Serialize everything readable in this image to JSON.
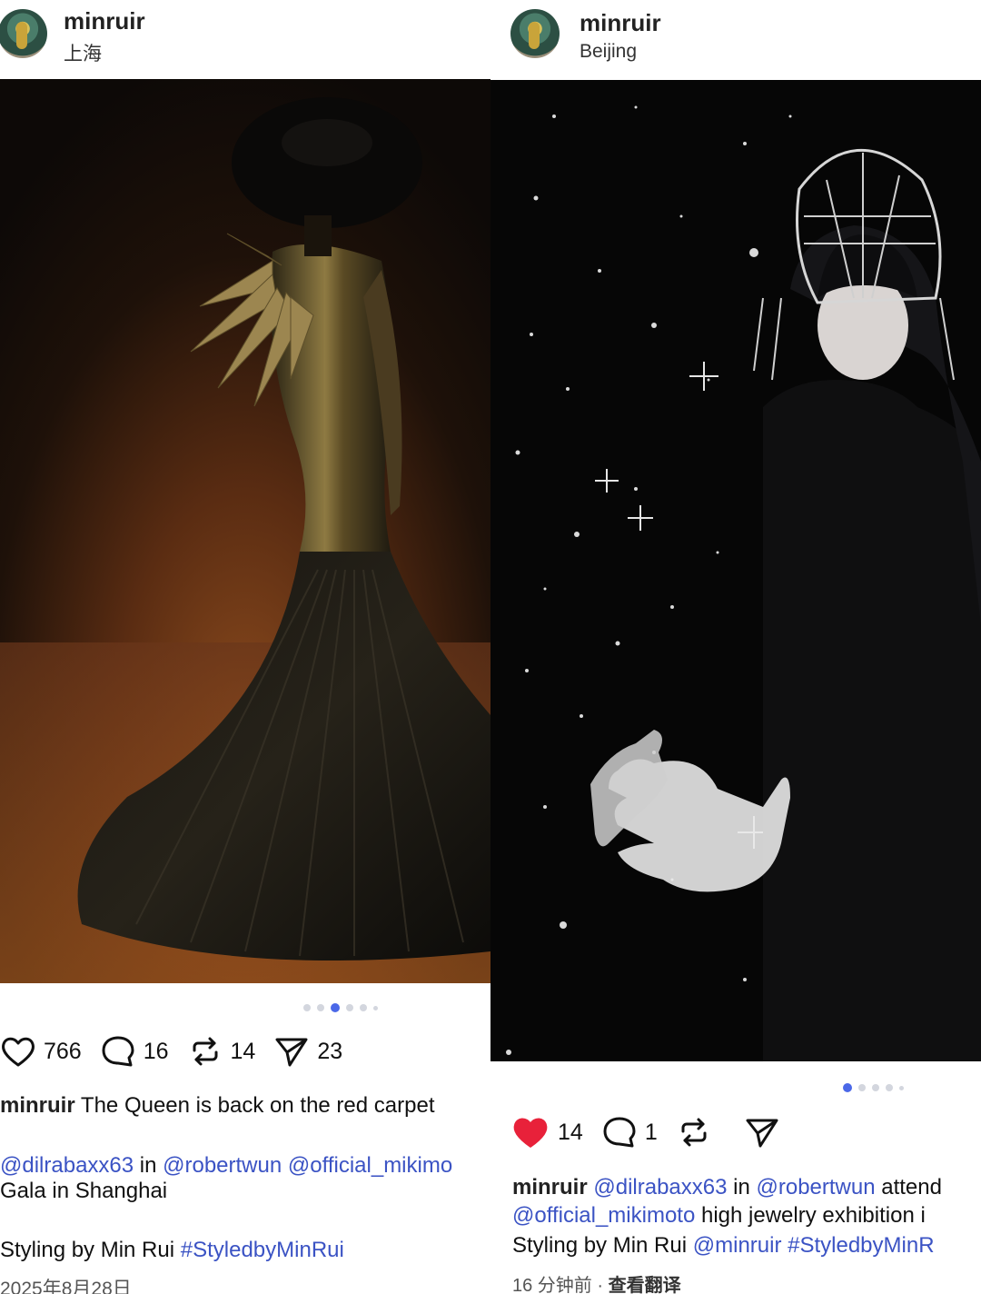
{
  "left_post": {
    "username": "minruir",
    "location": "上海",
    "likes": "766",
    "comments": "16",
    "reposts": "14",
    "shares": "23",
    "caption_user": "minruir",
    "caption_line1": " The Queen is back on the red carpet",
    "mention_1": "@dilrabaxx63",
    "in_word": " in ",
    "mention_2": "@robertwun",
    "mention_3": " @official_mikimo",
    "caption_line3": "Gala in Shanghai",
    "styling_text": "Styling by Min Rui ",
    "hashtag": "#StyledbyMinRui",
    "date": "2025年8月28日",
    "carousel_active_index": 2,
    "carousel_count": 6
  },
  "right_post": {
    "username": "minruir",
    "location": "Beijing",
    "likes": "14",
    "comments": "1",
    "liked": true,
    "caption_user": "minruir",
    "mention_1": " @dilrabaxx63",
    "in_word": " in ",
    "mention_2": "@robertwun",
    "tail_1": " attend",
    "mention_3": "@official_mikimoto",
    "tail_2": " high jewelry exhibition i",
    "styling_text": "Styling by Min Rui ",
    "mention_4": "@minruir",
    "hashtag": " #StyledbyMinR",
    "time_ago": "16 分钟前",
    "sep": " · ",
    "translate": "查看翻译",
    "carousel_active_index": 0,
    "carousel_count": 5
  },
  "colors": {
    "link": "#3b53c4",
    "heart_liked": "#e8213a",
    "carousel_active": "#4b68e8"
  }
}
